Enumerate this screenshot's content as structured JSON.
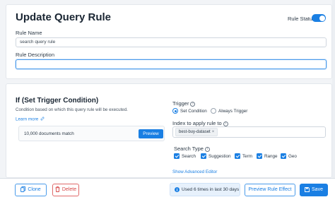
{
  "header": {
    "title": "Update Query Rule",
    "status_label": "Rule Status",
    "status_on": true
  },
  "rule_name": {
    "label": "Rule Name",
    "value": "search query rule"
  },
  "rule_description": {
    "label": "Rule Description",
    "value": ""
  },
  "condition": {
    "title": "If (Set Trigger Condition)",
    "description": "Condition based on which this query rule will be executed.",
    "learn_more": "Learn more",
    "match_text": "10,000 documents match",
    "preview_label": "Preview"
  },
  "trigger": {
    "label": "Trigger",
    "options": [
      "Set Condition",
      "Always Trigger"
    ],
    "selected": "Set Condition"
  },
  "index": {
    "label": "Index to apply rule to",
    "tags": [
      "best-buy-dataset"
    ]
  },
  "search_type": {
    "label": "Search Type",
    "options": [
      "Search",
      "Suggestion",
      "Term",
      "Range",
      "Geo"
    ],
    "checked": [
      "Search",
      "Suggestion",
      "Term",
      "Range",
      "Geo"
    ]
  },
  "advanced_editor": "Show Advanced Editor",
  "footer": {
    "clone_label": "Clone",
    "delete_label": "Delete",
    "usage_text": "Used 6 times in last 30 days",
    "preview_effect_label": "Preview Rule Effect",
    "save_label": "Save"
  },
  "colors": {
    "accent": "#1a7fe3",
    "danger": "#d64545",
    "usage_bg": "#e7f1fc"
  },
  "icons": [
    "info-icon",
    "link-icon",
    "close-icon",
    "copy-icon",
    "trash-icon",
    "save-icon"
  ]
}
